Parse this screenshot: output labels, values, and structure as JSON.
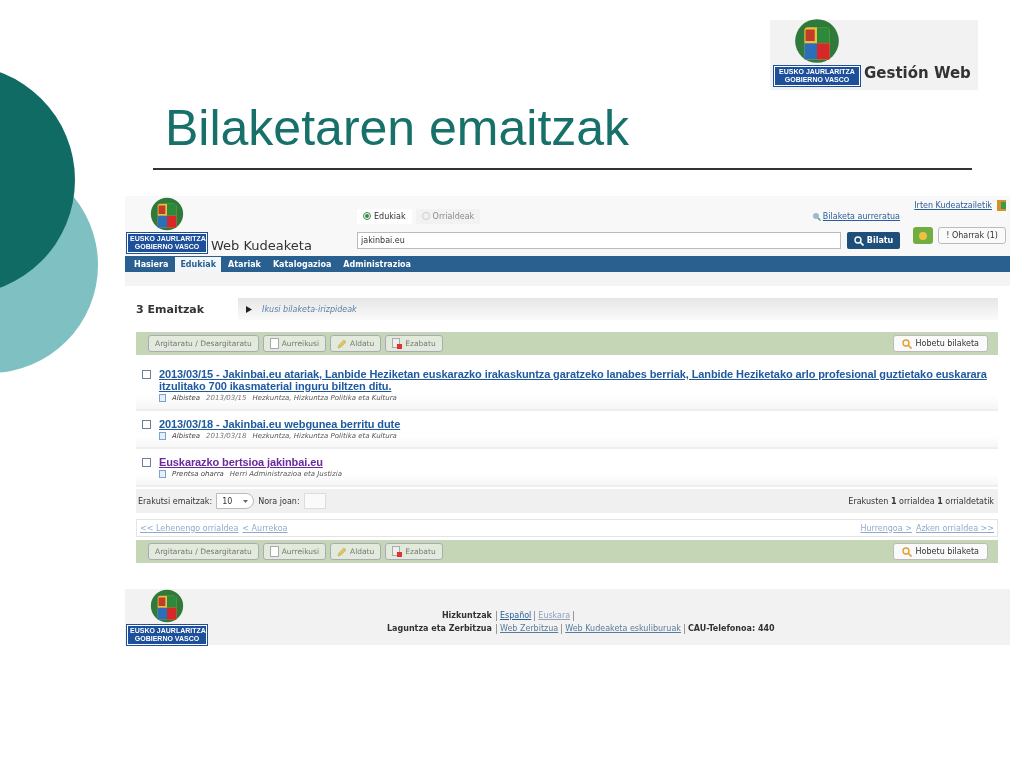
{
  "slide": {
    "title": "Bilaketaren emaitzak",
    "logo": {
      "line_1": "EUSKO JAURLARITZA",
      "line_2": "GOBIERNO VASCO",
      "product": "Gestión Web"
    }
  },
  "app": {
    "logo": {
      "line_1": "EUSKO JAURLARITZA",
      "line_2": "GOBIERNO VASCO"
    },
    "app_name": "Web Kudeaketa",
    "scope_options": [
      {
        "label": "Edukiak",
        "selected": true
      },
      {
        "label": "Orrialdeak",
        "selected": false
      }
    ],
    "advanced_search_link": "Bilaketa aurreratua",
    "logout_link": "Irten Kudeatzailetik",
    "search": {
      "value": "jakinbai.eu"
    },
    "search_button": "Bilatu",
    "notes_button": "! Oharrak (1)",
    "nav": [
      {
        "label": "Hasiera",
        "selected": false
      },
      {
        "label": "Edukiak",
        "selected": true
      },
      {
        "label": "Atariak",
        "selected": false
      },
      {
        "label": "Katalogazioa",
        "selected": false
      },
      {
        "label": "Administrazioa",
        "selected": false
      }
    ],
    "results_count": "3 Emaitzak",
    "criteria_toggle": "Ikusi bilaketa-irizpideak",
    "toolbars": [
      {
        "actions": [
          {
            "label": "Argitaratu / Desargitaratu",
            "kind": "plain",
            "disabled": true
          },
          {
            "label": "Aurreikusi",
            "kind": "preview",
            "disabled": true
          },
          {
            "label": "Aldatu",
            "kind": "edit",
            "disabled": true
          },
          {
            "label": "Ezabatu",
            "kind": "delete",
            "disabled": true
          }
        ],
        "refine_button": "Hobetu bilaketa"
      },
      {
        "actions": [
          {
            "label": "Argitaratu / Desargitaratu",
            "kind": "plain",
            "disabled": true
          },
          {
            "label": "Aurreikusi",
            "kind": "preview",
            "disabled": true
          },
          {
            "label": "Aldatu",
            "kind": "edit",
            "disabled": true
          },
          {
            "label": "Ezabatu",
            "kind": "delete",
            "disabled": true
          }
        ],
        "refine_button": "Hobetu bilaketa"
      }
    ],
    "results": [
      {
        "title": "2013/03/15 - Jakinbai.eu atariak, Lanbide Heziketan euskarazko irakaskuntza garatzeko lanabes berriak, Lanbide Heziketako arlo profesional guztietako euskarara itzulitako 700 ikasmaterial inguru biltzen ditu.",
        "visited": false,
        "checked": false,
        "type": "Albistea",
        "date": "2013/03/15",
        "category": "Hezkuntza, Hizkuntza Politika eta Kultura"
      },
      {
        "title": "2013/03/18 - Jakinbai.eu webgunea berritu dute",
        "visited": false,
        "checked": false,
        "type": "Albistea",
        "date": "2013/03/18",
        "category": "Hezkuntza, Hizkuntza Politika eta Kultura"
      },
      {
        "title": "Euskarazko bertsioa jakinbai.eu",
        "visited": true,
        "checked": false,
        "type": "Prentsa oharra",
        "category": "Herri Administrazioa eta Justizia"
      }
    ],
    "page_size_label": "Erakutsi emaitzak:",
    "page_size": "10",
    "goto_label": "Nora joan:",
    "page_status": "Erakusten **1** orrialdea **1** orrialdetatik",
    "pager_prev": [
      "<< Lehenengo orrialdea",
      "< Aurrekoa"
    ],
    "pager_next": [
      "Hurrengoa >",
      "Azken orrialdea >>"
    ],
    "footer": {
      "logo": {
        "line_1": "EUSKO JAURLARITZA",
        "line_2": "GOBIERNO VASCO"
      },
      "languages_label": "Hizkuntzak",
      "languages": [
        {
          "label": "Español",
          "selected": false
        },
        {
          "label": "Euskara",
          "selected": true
        }
      ],
      "help_label": "Laguntza eta Zerbitzua",
      "help_links": [
        "Web Zerbitzua",
        "Web Kudeaketa eskuliburuak"
      ],
      "phone": "CAU-Telefonoa: 440"
    }
  }
}
